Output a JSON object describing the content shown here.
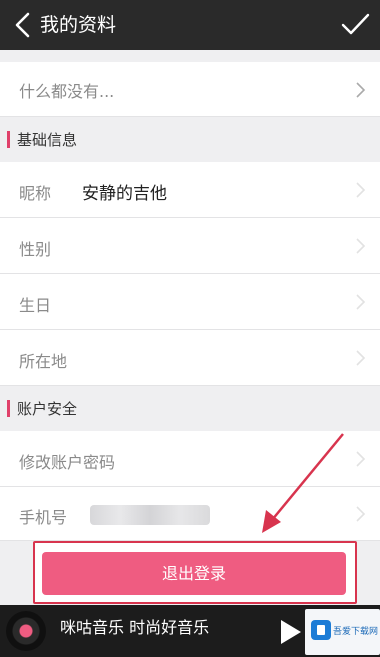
{
  "header": {
    "title": "我的资料",
    "back_icon": "chevron-left-icon",
    "confirm_icon": "checkmark-icon"
  },
  "signature": {
    "placeholder_text": "什么都没有..."
  },
  "basic_info": {
    "section_title": "基础信息",
    "nickname_label": "昵称",
    "nickname_value": "安静的吉他",
    "gender_label": "性别",
    "birthday_label": "生日",
    "location_label": "所在地"
  },
  "account_security": {
    "section_title": "账户安全",
    "change_password_label": "修改账户密码",
    "phone_label": "手机号"
  },
  "logout": {
    "label": "退出登录"
  },
  "player": {
    "title": "咪咕音乐 时尚好音乐"
  },
  "watermark": {
    "text": "吾爱下载网"
  },
  "colors": {
    "accent": "#ef5c81",
    "section_bar": "#e0406a",
    "highlight_border": "#d8344e",
    "topbar": "#2a2a2a"
  }
}
